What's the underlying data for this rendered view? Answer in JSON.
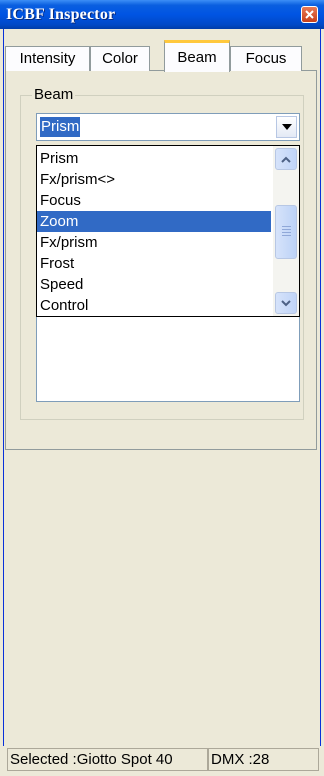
{
  "window": {
    "title": "ICBF Inspector"
  },
  "tabs": [
    {
      "label": "Intensity"
    },
    {
      "label": "Color"
    },
    {
      "label": "Beam",
      "active": true
    },
    {
      "label": "Focus"
    }
  ],
  "beam": {
    "group_label": "Beam",
    "combo_value": "Prism",
    "options": [
      "Prism",
      "Fx/prism<>",
      "Focus",
      "Zoom",
      "Fx/prism",
      "Frost",
      "Speed",
      "Control"
    ],
    "highlighted_option": "Zoom"
  },
  "status": {
    "selected_text": "Selected :Giotto Spot 40",
    "dmx_text": "DMX :28"
  },
  "colors": {
    "title_bar": "#0054e3",
    "selection": "#316ac5",
    "close_button": "#c8401b",
    "window_face": "#ece9d8",
    "active_tab_accent": "#ffc83c"
  }
}
